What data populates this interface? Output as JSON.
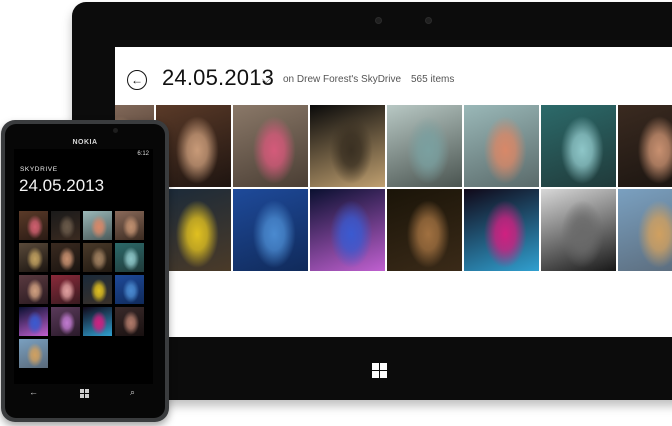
{
  "tablet": {
    "header": {
      "back_glyph": "←",
      "date": "24.05.2013",
      "chevron": "⌵",
      "owner": "on Drew Forest's SkyDrive",
      "count": "565 items"
    },
    "photos": [
      {
        "name": "photo-hand-portrait",
        "colors": [
          "#5a3a28",
          "#c89a78",
          "#1e1410"
        ]
      },
      {
        "name": "photo-skater-pink",
        "colors": [
          "#8a7868",
          "#d45a7a",
          "#4a3e34"
        ]
      },
      {
        "name": "photo-skater-night",
        "colors": [
          "#0a0a0a",
          "#3a3022",
          "#c0a070"
        ]
      },
      {
        "name": "photo-dancer-pool",
        "colors": [
          "#b8c8c4",
          "#7aa0a0",
          "#4a5450"
        ]
      },
      {
        "name": "photo-dancer-courtyard",
        "colors": [
          "#9ab8b8",
          "#d88868",
          "#5a6a6a"
        ]
      },
      {
        "name": "photo-dancers-teal",
        "colors": [
          "#2c6a6a",
          "#8ec6c8",
          "#203a3a"
        ]
      },
      {
        "name": "photo-two-friends",
        "colors": [
          "#3a2a20",
          "#c89070",
          "#1a1410"
        ]
      },
      {
        "name": "photo-group-skate",
        "colors": [
          "#6a5a4a",
          "#b09070",
          "#2a201a"
        ]
      },
      {
        "name": "photo-yellow-shirt",
        "colors": [
          "#1a2a3a",
          "#e0c020",
          "#4a3a28"
        ]
      },
      {
        "name": "photo-blue-wall",
        "colors": [
          "#1e4a9a",
          "#4a8ad0",
          "#102a5a"
        ]
      },
      {
        "name": "photo-neon-tunnel",
        "colors": [
          "#0a1030",
          "#3a5ad0",
          "#c060d0"
        ]
      },
      {
        "name": "photo-girl-dog",
        "colors": [
          "#1a1408",
          "#a07040",
          "#3a2a18"
        ]
      },
      {
        "name": "photo-fireworks-ride",
        "colors": [
          "#100818",
          "#d02080",
          "#30a0d0"
        ]
      },
      {
        "name": "photo-swing-girl",
        "colors": [
          "#d8d8d8",
          "#6a6a6a",
          "#181818"
        ]
      },
      {
        "name": "photo-pier-beach",
        "colors": [
          "#7aa0c0",
          "#d0a060",
          "#5a6a7a"
        ]
      }
    ],
    "extra_tiles": [
      {
        "name": "photo-edge-top",
        "colors": [
          "#8a7060",
          "#c0a080",
          "#3a2a20"
        ]
      },
      {
        "name": "photo-edge-bottom",
        "colors": [
          "#3a6a9a",
          "#d0b080",
          "#1a2a3a"
        ]
      }
    ]
  },
  "phone": {
    "brand": "NOKIA",
    "time": "6:12",
    "app_title": "SKYDRIVE",
    "date": "24.05.2013",
    "photos": [
      {
        "name": "phone-photo-1",
        "colors": [
          "#5a3a28",
          "#d06070",
          "#2a1a14"
        ]
      },
      {
        "name": "phone-photo-2",
        "colors": [
          "#1a1a1a",
          "#6a5a4a",
          "#3a2a20"
        ]
      },
      {
        "name": "phone-photo-3",
        "colors": [
          "#9ab8b8",
          "#d88868",
          "#4a5a5a"
        ]
      },
      {
        "name": "phone-photo-4",
        "colors": [
          "#8a6a5a",
          "#c09070",
          "#3a2a20"
        ]
      },
      {
        "name": "phone-photo-5",
        "colors": [
          "#5a4a3a",
          "#c0a060",
          "#1a1410"
        ]
      },
      {
        "name": "phone-photo-6",
        "colors": [
          "#3a2a20",
          "#c89070",
          "#1a1410"
        ]
      },
      {
        "name": "phone-photo-7",
        "colors": [
          "#4a3a2a",
          "#a08060",
          "#201810"
        ]
      },
      {
        "name": "phone-photo-8",
        "colors": [
          "#2c6a6a",
          "#8ec6c8",
          "#203a3a"
        ]
      },
      {
        "name": "phone-photo-9",
        "colors": [
          "#5a3a40",
          "#d0a080",
          "#2a1a20"
        ]
      },
      {
        "name": "phone-photo-10",
        "colors": [
          "#8a2a3a",
          "#e0a0a0",
          "#3a1a20"
        ]
      },
      {
        "name": "phone-photo-11",
        "colors": [
          "#1a2a3a",
          "#e0c020",
          "#3a3028"
        ]
      },
      {
        "name": "phone-photo-12",
        "colors": [
          "#1e4a9a",
          "#4a8ad0",
          "#102a5a"
        ]
      },
      {
        "name": "phone-photo-13",
        "colors": [
          "#0a1030",
          "#3a5ad0",
          "#c060d0"
        ]
      },
      {
        "name": "phone-photo-14",
        "colors": [
          "#5a3a5a",
          "#c07ad0",
          "#2a1a2a"
        ]
      },
      {
        "name": "phone-photo-15",
        "colors": [
          "#100818",
          "#d02080",
          "#30a0d0"
        ]
      },
      {
        "name": "phone-photo-16",
        "colors": [
          "#3a2a2a",
          "#b07a6a",
          "#181010"
        ]
      },
      {
        "name": "phone-photo-17",
        "colors": [
          "#7aa0c0",
          "#d0a060",
          "#5a6a7a"
        ]
      }
    ],
    "nav": {
      "back_glyph": "←",
      "search_glyph": "⌕"
    }
  }
}
